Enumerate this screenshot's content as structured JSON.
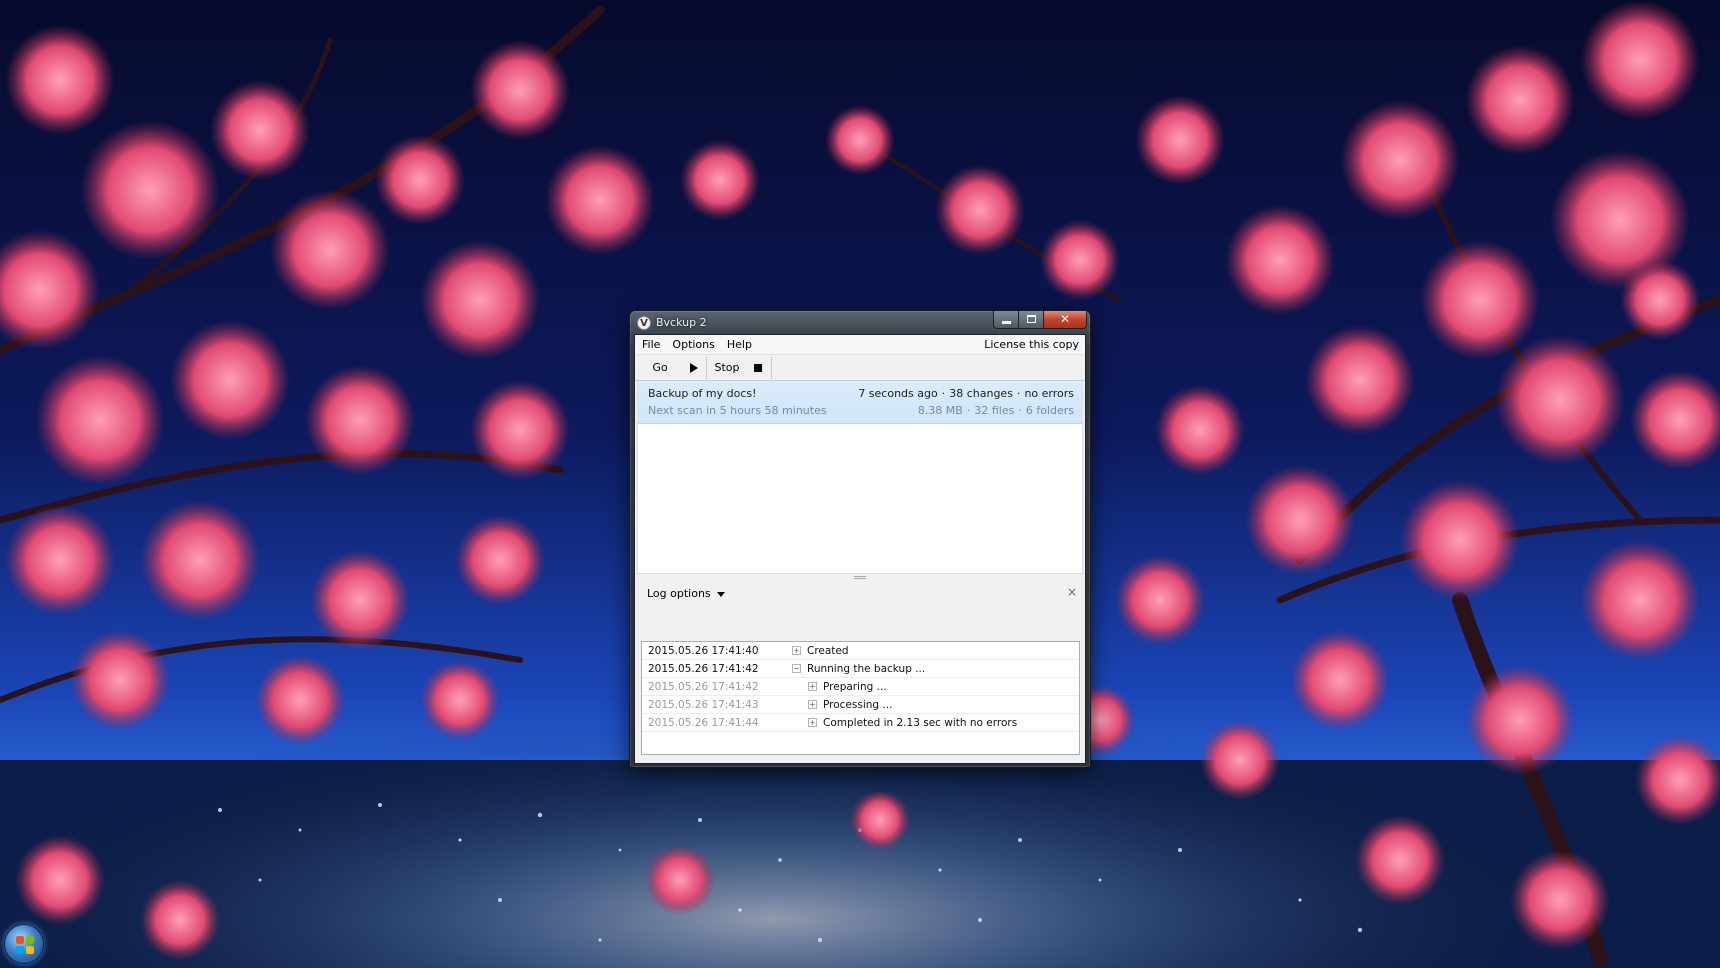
{
  "window": {
    "title": "Bvckup 2",
    "app_icon_glyph": "V",
    "caption": {
      "minimize": "",
      "maximize": "",
      "close": "✕"
    }
  },
  "menu": {
    "items": [
      "File",
      "Options",
      "Help"
    ],
    "license": "License this copy"
  },
  "toolbar": {
    "go_label": "Go",
    "stop_label": "Stop",
    "icons": [
      "play-icon",
      "stop-icon"
    ]
  },
  "job": {
    "name": "Backup of my docs!",
    "next_scan": "Next scan in 5 hours 58 minutes",
    "last_run": "7 seconds ago",
    "changes": "38 changes",
    "errors": "no errors",
    "size": "8.38 MB",
    "files": "32 files",
    "folders": "6 folders"
  },
  "log": {
    "options_label": "Log options",
    "close_glyph": "×",
    "rows": [
      {
        "time": "2015.05.26 17:41:40",
        "toggle": "+",
        "text": "Created"
      },
      {
        "time": "2015.05.26 17:41:42",
        "toggle": "−",
        "text": "Running the backup ..."
      },
      {
        "time": "2015.05.26 17:41:42",
        "toggle": "+",
        "text": "Preparing ..."
      },
      {
        "time": "2015.05.26 17:41:43",
        "toggle": "+",
        "text": "Processing ..."
      },
      {
        "time": "2015.05.26 17:41:44",
        "toggle": "+",
        "text": "Completed in 2.13 sec with no errors"
      }
    ]
  },
  "colors": {
    "selection": "#cfe5fa",
    "close_button": "#c2442c",
    "sky": "#0a0f3a",
    "blossom": "#e8507a"
  }
}
